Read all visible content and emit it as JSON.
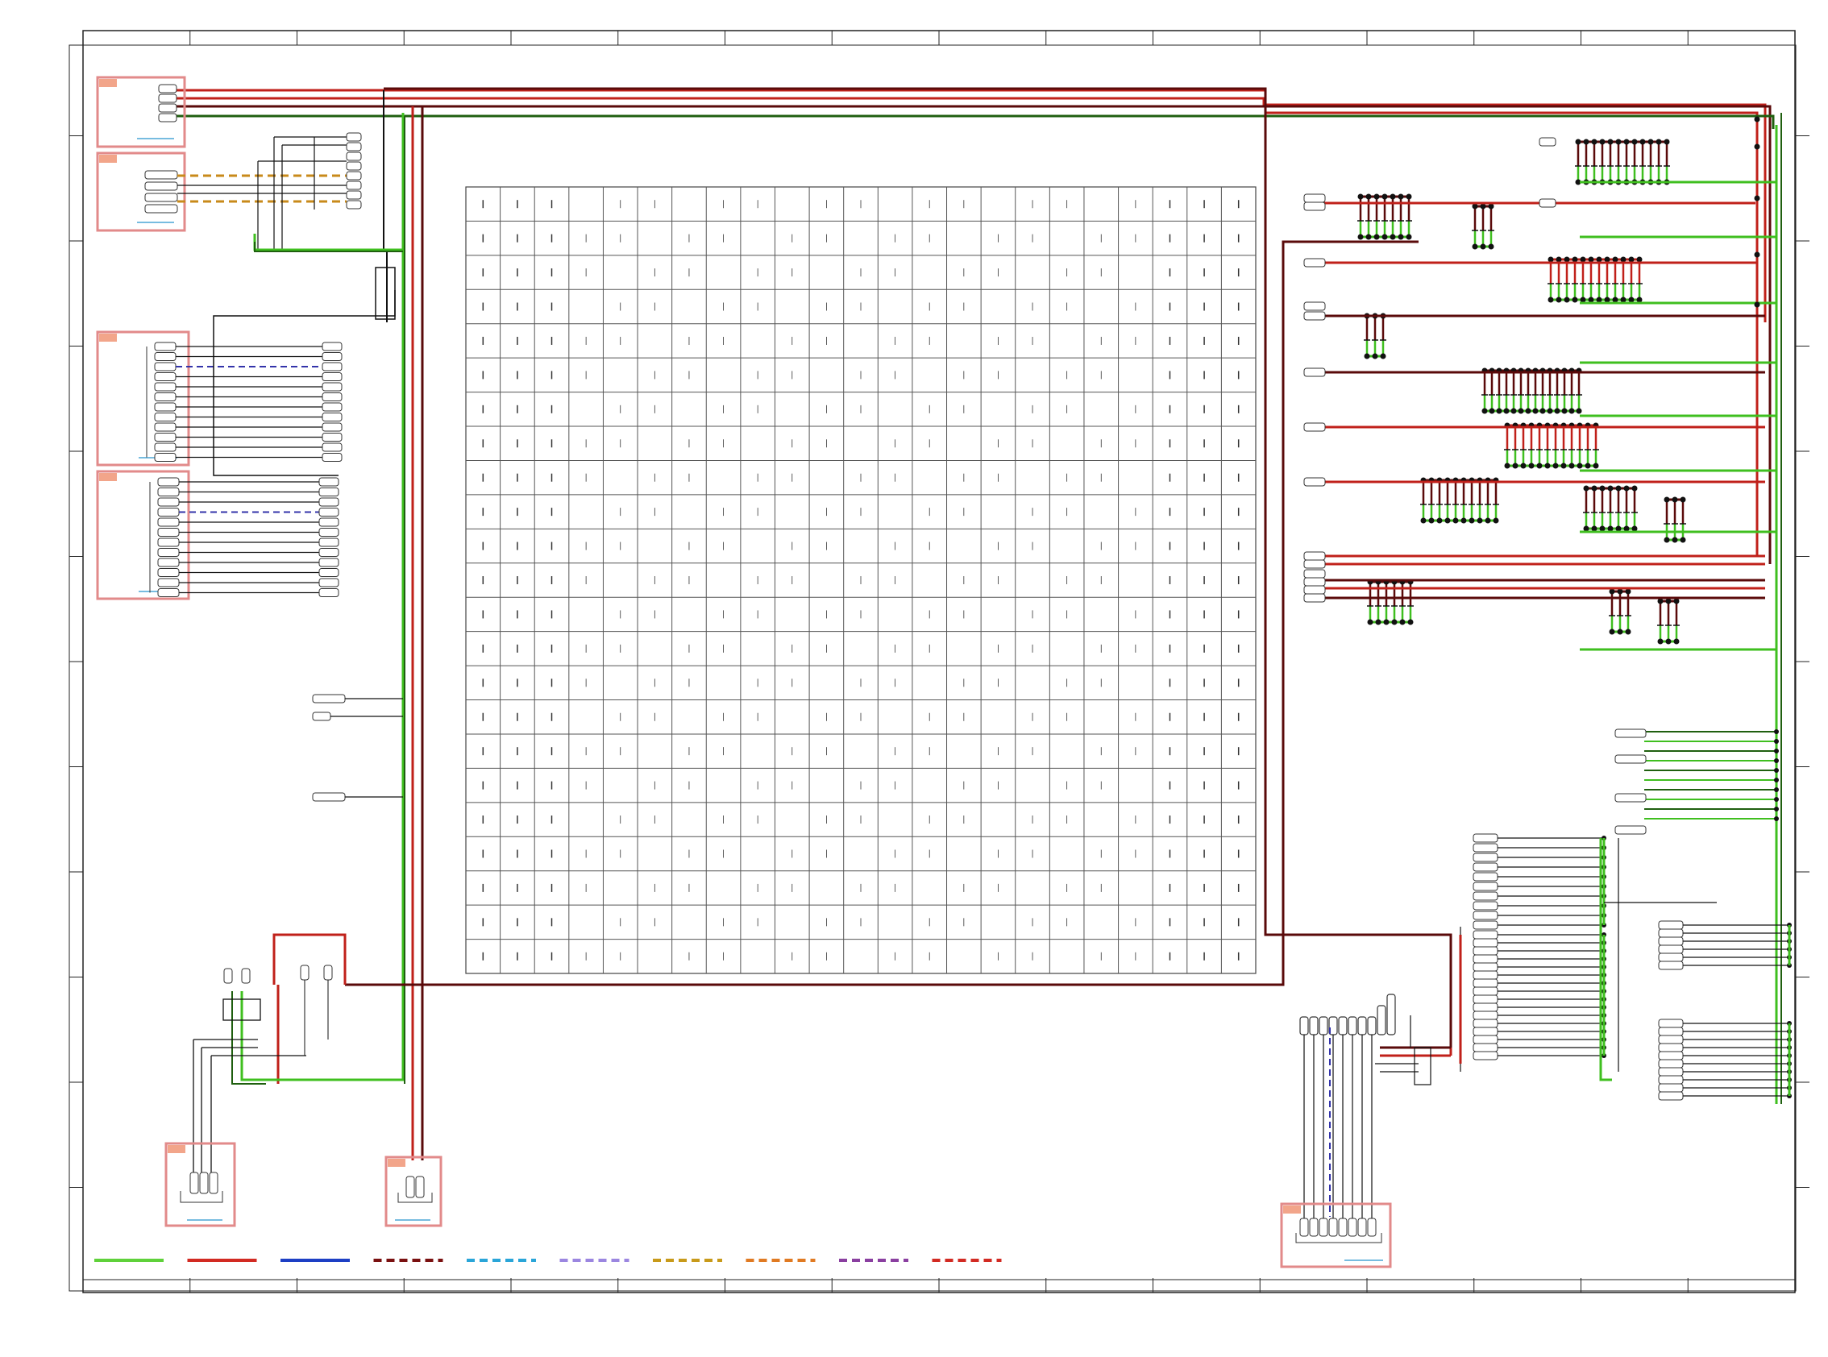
{
  "sheet": {
    "background": "#ffffff",
    "border_color": "#222222",
    "zone_count_horizontal": 16,
    "zone_count_vertical": 12
  },
  "colors": {
    "power_green": "#3fbf1f",
    "signal_red": "#c0201a",
    "wire_darkred": "#5a0a0a",
    "wire_black": "#111111",
    "dashed_blue": "#3333aa",
    "dashed_orange": "#c88a1a",
    "connector_box": "#e28a8a",
    "connector_tab": "#f2a58a",
    "connector_label": "#4aa6d6",
    "grid_line": "#555555"
  },
  "legend": [
    {
      "name": "legend-green-solid",
      "color": "#5fd13a",
      "style": "solid"
    },
    {
      "name": "legend-red-solid",
      "color": "#d22a22",
      "style": "solid"
    },
    {
      "name": "legend-blue-solid",
      "color": "#1d3fc4",
      "style": "solid"
    },
    {
      "name": "legend-darkred-dashed",
      "color": "#7a1010",
      "style": "dashed"
    },
    {
      "name": "legend-cyan-dashed",
      "color": "#2aa5d8",
      "style": "dashed"
    },
    {
      "name": "legend-lavender-dashed",
      "color": "#9b86e0",
      "style": "dashed"
    },
    {
      "name": "legend-gold-dashed",
      "color": "#c89a1a",
      "style": "dashed"
    },
    {
      "name": "legend-orange-dashed",
      "color": "#e07a22",
      "style": "dashed"
    },
    {
      "name": "legend-purple-dashed",
      "color": "#8a3fa0",
      "style": "dashed"
    },
    {
      "name": "legend-red-dashed",
      "color": "#d22a22",
      "style": "dashed"
    }
  ],
  "grid": {
    "columns": 23,
    "rows": 23
  }
}
